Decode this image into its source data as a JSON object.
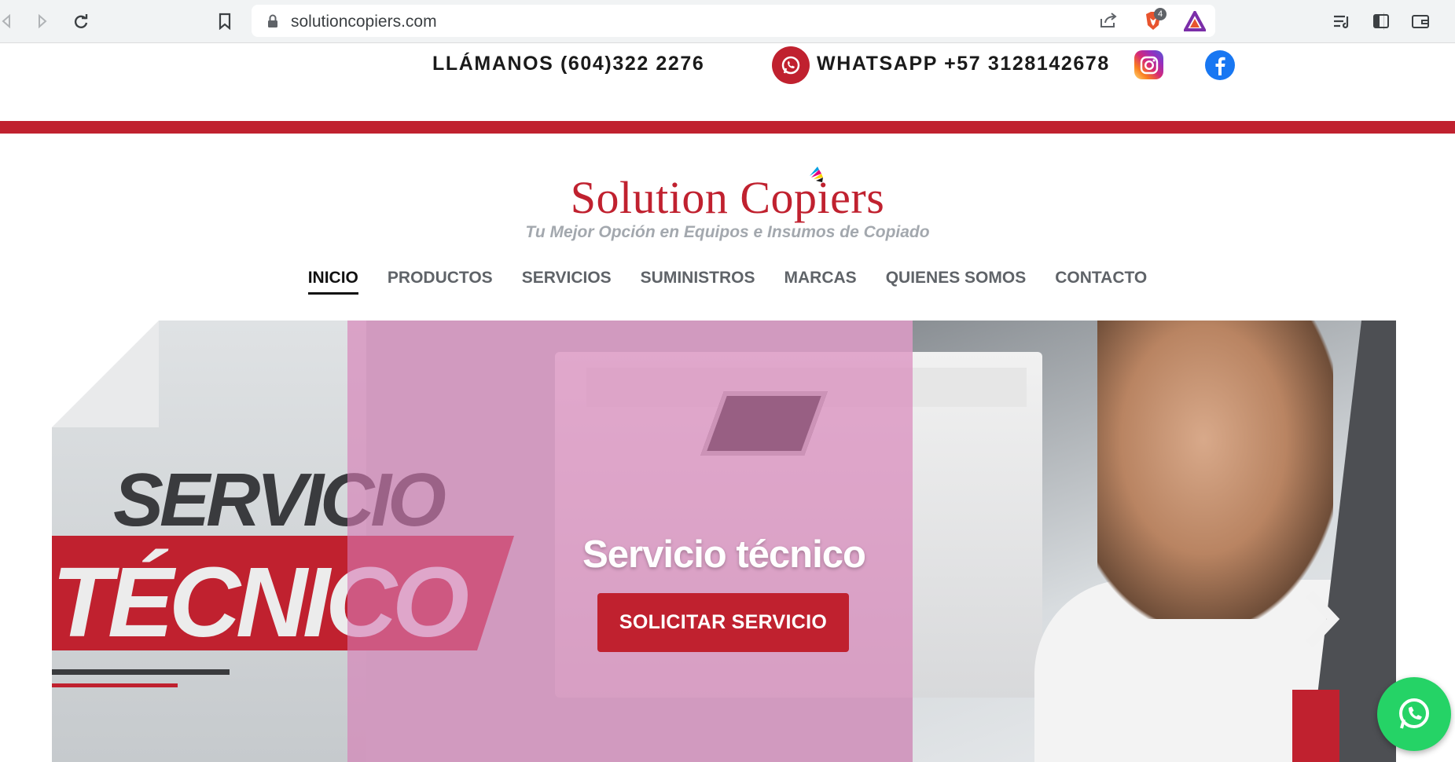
{
  "browser": {
    "url": "solutioncopiers.com",
    "shield_badge_count": "4"
  },
  "contact": {
    "phone_text": "LLÁMANOS (604)322 2276",
    "whatsapp_text": "WHATSAPP +57 3128142678"
  },
  "header": {
    "logo_text": "Solution Copiers",
    "tagline": "Tu Mejor Opción en Equipos e Insumos de Copiado"
  },
  "nav": {
    "items": [
      {
        "label": "INICIO",
        "active": true
      },
      {
        "label": "PRODUCTOS",
        "active": false
      },
      {
        "label": "SERVICIOS",
        "active": false
      },
      {
        "label": "SUMINISTROS",
        "active": false
      },
      {
        "label": "MARCAS",
        "active": false
      },
      {
        "label": "QUIENES SOMOS",
        "active": false
      },
      {
        "label": "CONTACTO",
        "active": false
      }
    ]
  },
  "hero": {
    "image_text_line1": "SERVICIO",
    "image_text_line2": "TÉCNICO",
    "title": "Servicio técnico",
    "button_label": "SOLICITAR SERVICIO"
  },
  "colors": {
    "brand_red": "#c0212f",
    "whatsapp_green": "#25d366",
    "facebook_blue": "#1877f2"
  },
  "icons": [
    "back-icon",
    "forward-icon",
    "reload-icon",
    "bookmark-icon",
    "lock-icon",
    "share-icon",
    "brave-shield-icon",
    "brave-rewards-icon",
    "reading-list-icon",
    "sidebar-icon",
    "wallet-icon",
    "whatsapp-icon",
    "instagram-icon",
    "facebook-icon",
    "chevron-right-icon"
  ]
}
